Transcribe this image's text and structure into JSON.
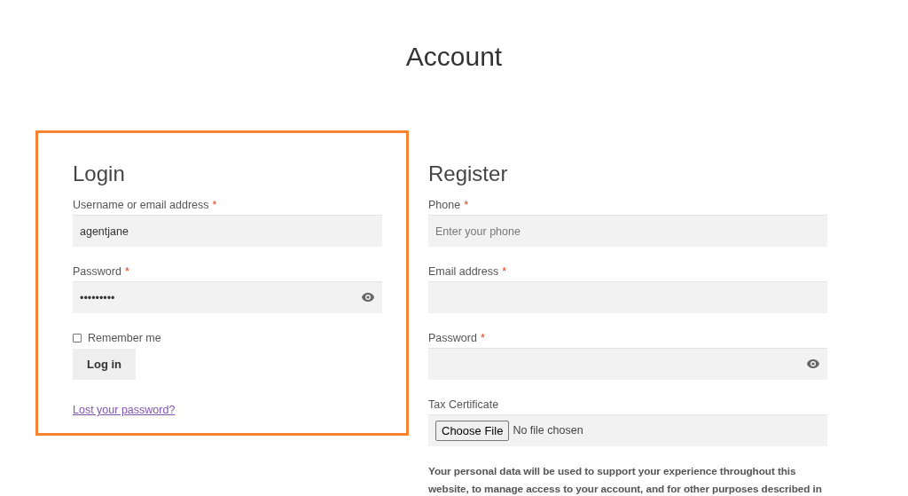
{
  "page_title": "Account",
  "login": {
    "title": "Login",
    "fields": [
      {
        "kind": "text",
        "label": "Username or email address",
        "required": "*",
        "value": "agentjane"
      },
      {
        "kind": "password",
        "label": "Password",
        "required": "*",
        "value": "•••••••••"
      }
    ],
    "remember": {
      "label": "Remember me",
      "checked": false
    },
    "button": "Log in",
    "lost_link": "Lost your password?",
    "highlighted": true
  },
  "register": {
    "title": "Register",
    "fields": [
      {
        "kind": "text",
        "label": "Phone",
        "required": "*",
        "placeholder": "Enter your phone"
      },
      {
        "kind": "text",
        "label": "Email address",
        "required": "*"
      },
      {
        "kind": "password",
        "label": "Password",
        "required": "*"
      },
      {
        "kind": "file",
        "label": "Tax Certificate",
        "button": "Choose File",
        "status": "No file chosen"
      }
    ],
    "privacy": "Your personal data will be used to support your experience throughout this website, to manage access to your account, and for other purposes described in"
  }
}
